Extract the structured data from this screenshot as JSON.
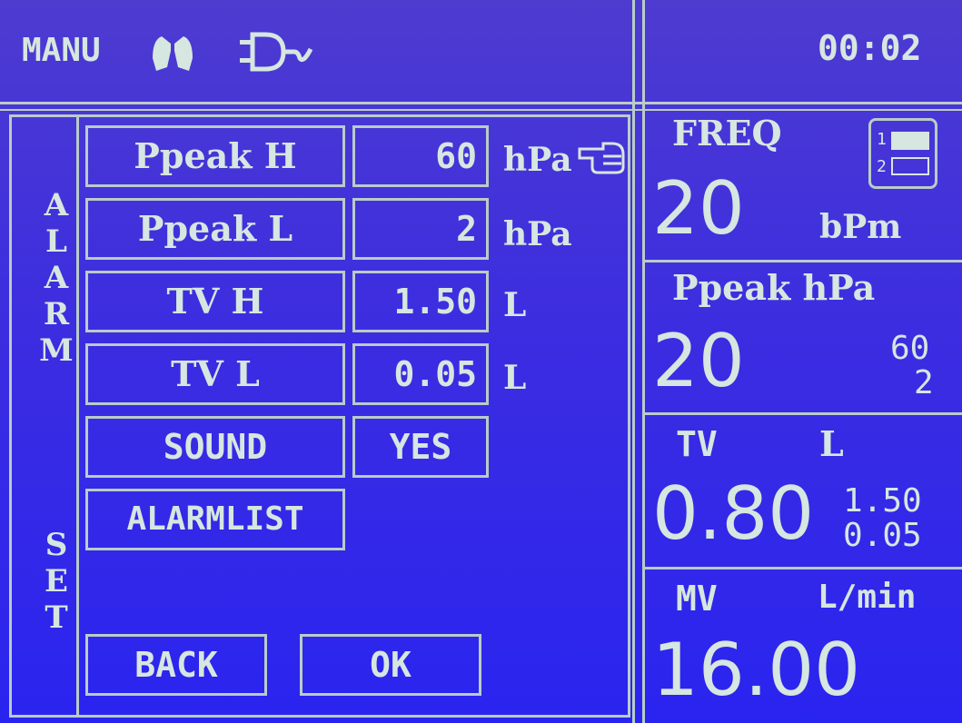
{
  "header": {
    "mode": "MANU",
    "time": "00:02",
    "icons": [
      "lungs-icon",
      "plug-icon"
    ]
  },
  "sidebar": {
    "word1": [
      "A",
      "L",
      "A",
      "R",
      "M"
    ],
    "word2": [
      "S",
      "E",
      "T"
    ]
  },
  "alarm_settings": [
    {
      "label": "Ppeak H",
      "value": "60",
      "unit": "hPa"
    },
    {
      "label": "Ppeak L",
      "value": "2",
      "unit": "hPa"
    },
    {
      "label": "TV H",
      "value": "1.50",
      "unit": "L"
    },
    {
      "label": "TV L",
      "value": "0.05",
      "unit": "L"
    }
  ],
  "sound": {
    "label": "SOUND",
    "value": "YES"
  },
  "alarmlist": {
    "label": "ALARMLIST"
  },
  "buttons": {
    "back": "BACK",
    "ok": "OK"
  },
  "monitor": {
    "freq": {
      "label": "FREQ",
      "value": "20",
      "unit": "bPm",
      "icon": "layout-toggle-icon",
      "icon_labels": [
        "1",
        "2"
      ]
    },
    "ppeak": {
      "label": "Ppeak hPa",
      "value": "20",
      "high": "60",
      "low": "2"
    },
    "tv": {
      "label": "TV",
      "unit": "L",
      "value": "0.80",
      "high": "1.50",
      "low": "0.05"
    },
    "mv": {
      "label": "MV",
      "unit": "L/min",
      "value": "16.00"
    }
  },
  "colors": {
    "background": "#3c2de0",
    "foreground": "#d6e6e0",
    "lines": "#b9ccc8"
  }
}
